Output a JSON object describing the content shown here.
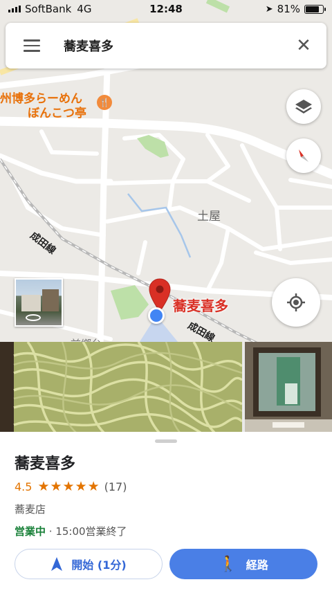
{
  "status_bar": {
    "carrier": "SoftBank",
    "network": "4G",
    "time": "12:48",
    "battery": "81%",
    "battery_level": 0.81
  },
  "search": {
    "query": "蕎麦喜多"
  },
  "map": {
    "labels": {
      "restaurant_line1": "州博多らーめん",
      "restaurant_line2": "ぼんこつ亭",
      "area": "土屋",
      "railway_1": "成田線",
      "railway_2": "成田線",
      "pin_label": "蕎麦喜多",
      "partial": "前鄉台"
    },
    "colors": {
      "pin": "#d93025",
      "park": "#bde0a8",
      "my_location": "#4285f4",
      "poi": "#f28b3c"
    }
  },
  "place": {
    "name": "蕎麦喜多",
    "rating": "4.5",
    "stars": "★★★★★",
    "review_count": "(17)",
    "category": "蕎麦店",
    "open_status": "営業中",
    "hours_detail": " · 15:00営業終了"
  },
  "actions": {
    "start_label": "開始 (1分)",
    "route_label": "経路"
  }
}
